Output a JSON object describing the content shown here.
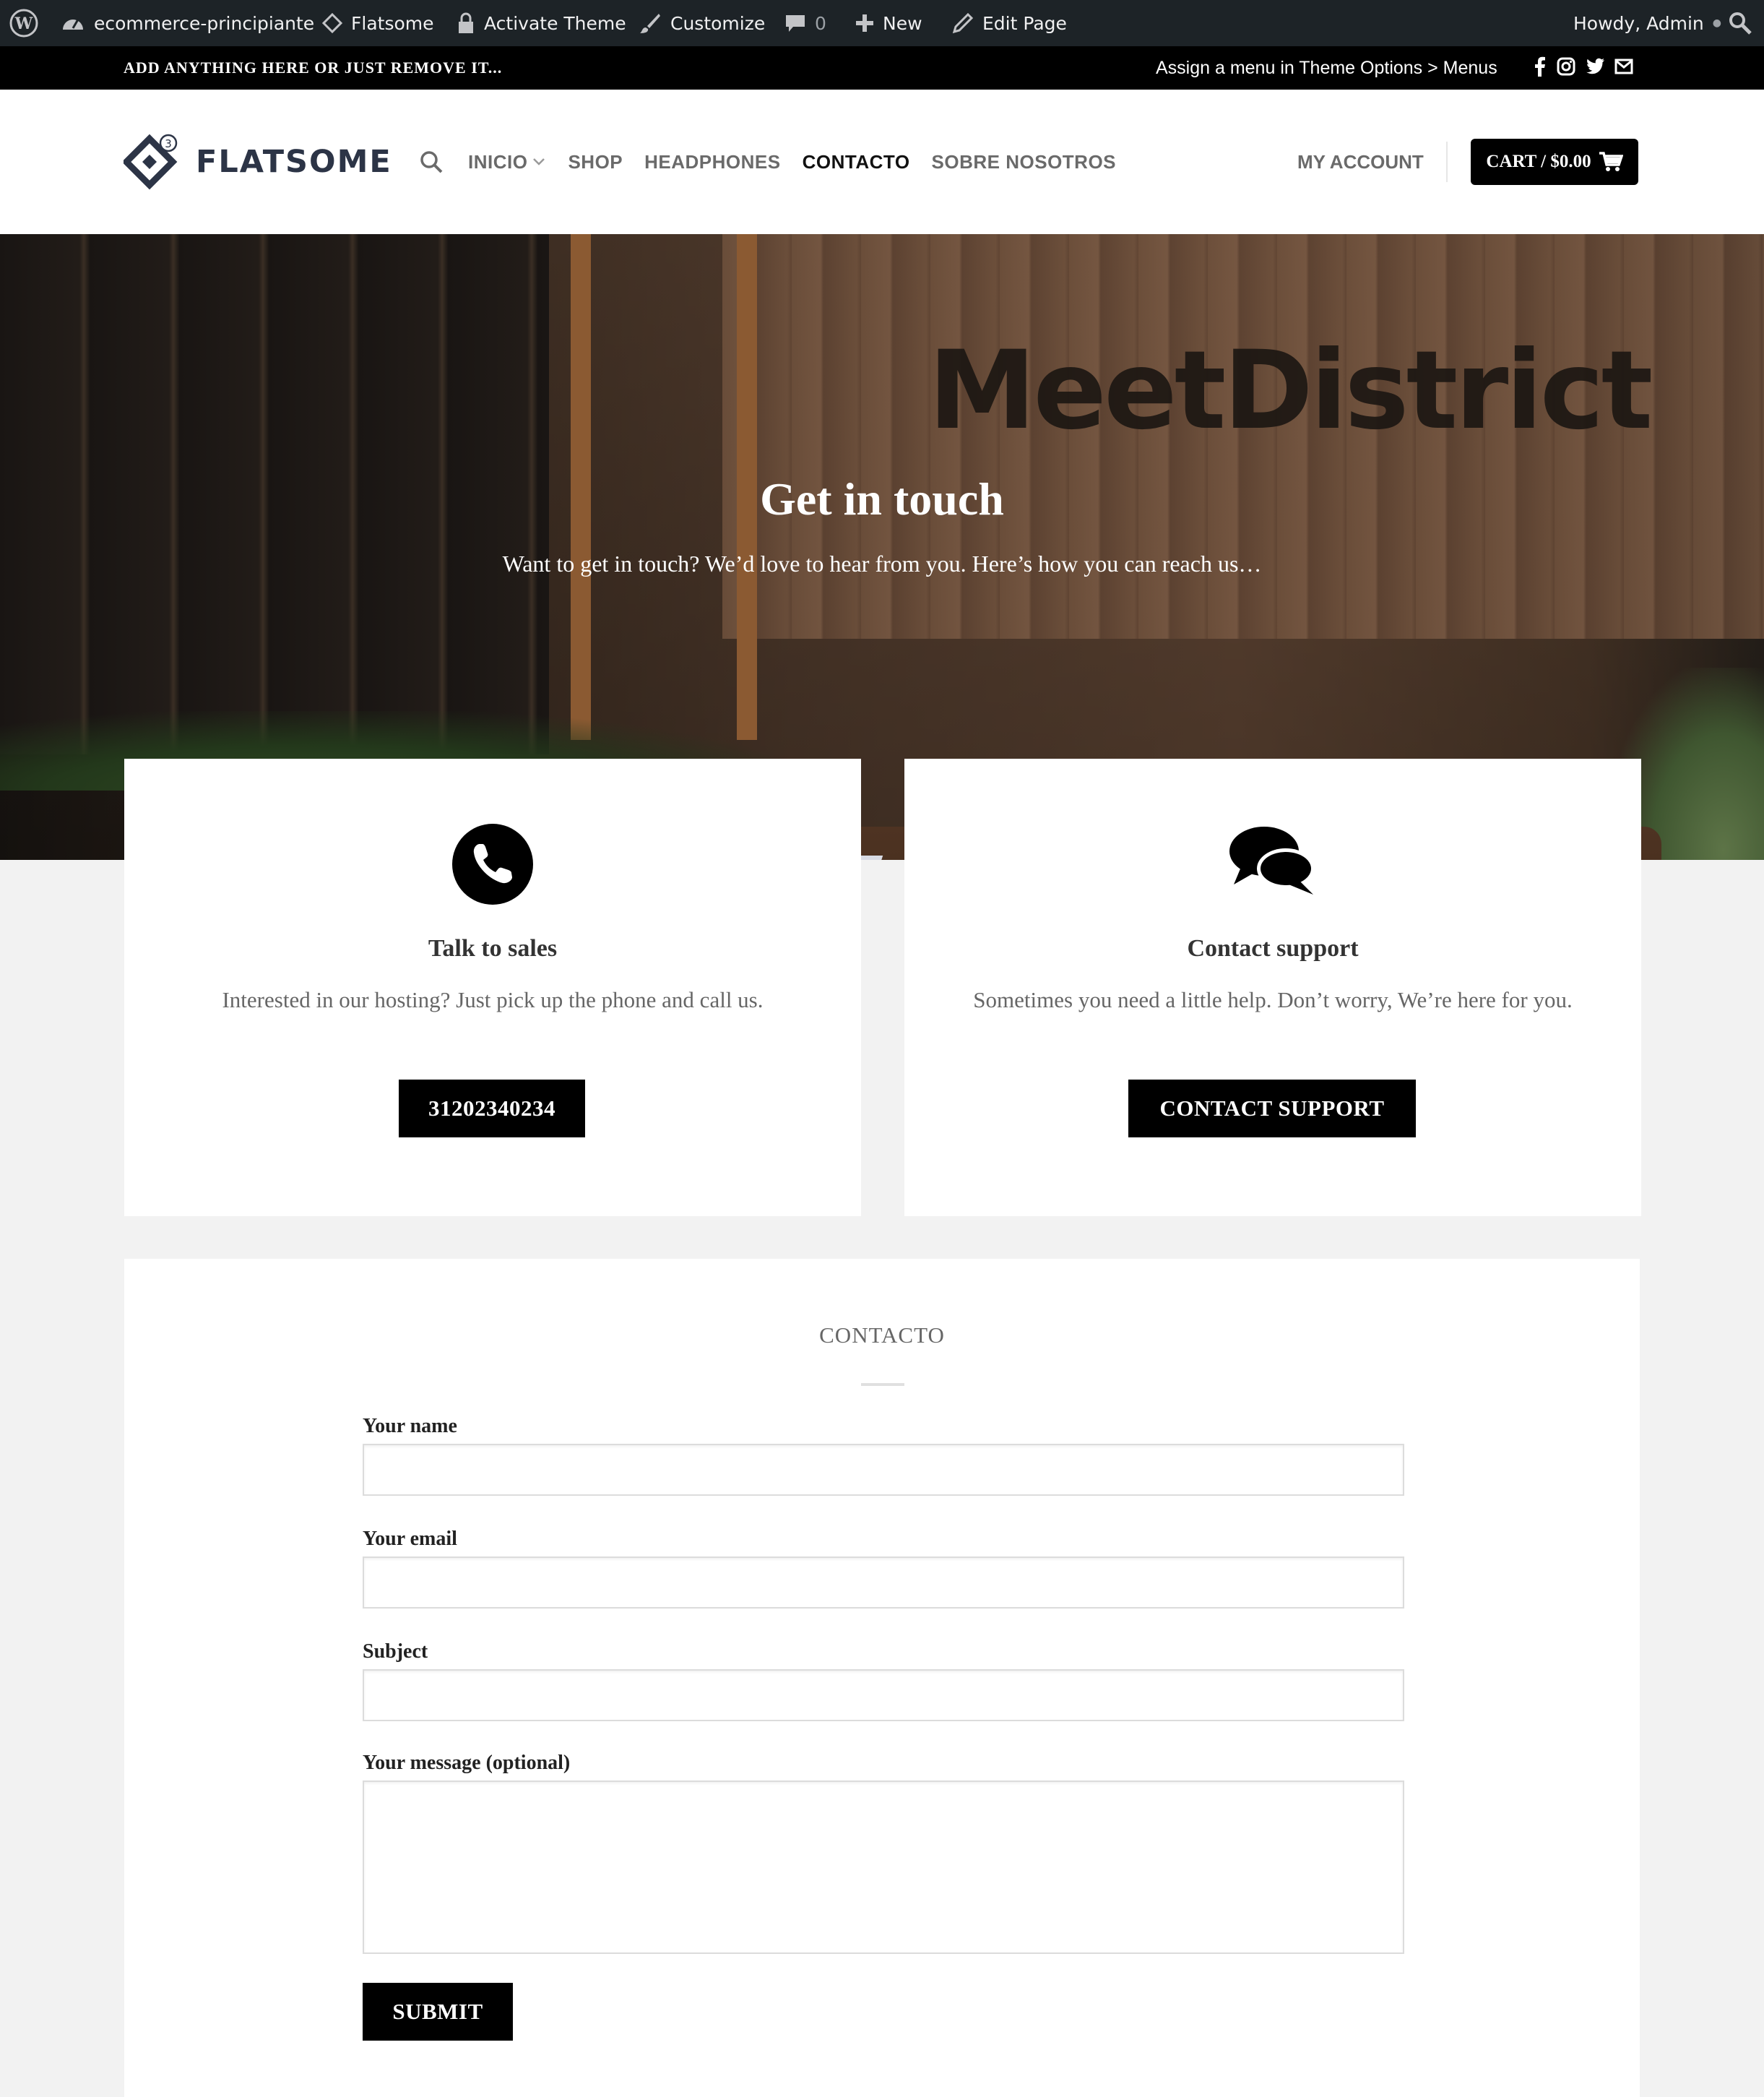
{
  "admin_bar": {
    "site_name": "ecommerce-principiante",
    "theme": "Flatsome",
    "activate_theme": "Activate Theme",
    "customize": "Customize",
    "comments_count": "0",
    "new": "New",
    "edit_page": "Edit Page",
    "howdy": "Howdy, Admin"
  },
  "top_bar": {
    "promo_text": "ADD ANYTHING HERE OR JUST REMOVE IT...",
    "menu_hint": "Assign a menu in Theme Options > Menus",
    "social_icons": [
      "facebook-icon",
      "instagram-icon",
      "twitter-icon",
      "envelope-icon"
    ]
  },
  "header": {
    "logo_text": "FLATSOME",
    "logo_badge": "3",
    "nav": [
      {
        "label": "INICIO",
        "has_dropdown": true
      },
      {
        "label": "SHOP"
      },
      {
        "label": "HEADPHONES"
      },
      {
        "label": "CONTACTO",
        "active": true
      },
      {
        "label": "SOBRE NOSOTROS"
      }
    ],
    "my_account": "MY ACCOUNT",
    "cart": "CART / $0.00"
  },
  "hero": {
    "sign_text": "MeetDistrict",
    "title": "Get in touch",
    "subtitle": "Want to get in touch? We’d love to hear from you. Here’s how you can reach us…"
  },
  "boxes": [
    {
      "icon": "phone-icon",
      "title": "Talk to sales",
      "text": "Interested in our hosting? Just pick up the phone and call us.",
      "button": "31202340234"
    },
    {
      "icon": "chat-bubbles-icon",
      "title": "Contact support",
      "text": "Sometimes you need a little help. Don’t worry, We’re here for you.",
      "button": "CONTACT SUPPORT"
    }
  ],
  "form": {
    "heading": "CONTACTO",
    "fields": [
      {
        "label": "Your name",
        "value": ""
      },
      {
        "label": "Your email",
        "value": ""
      },
      {
        "label": "Subject",
        "value": ""
      },
      {
        "label": "Your message (optional)",
        "value": ""
      }
    ],
    "submit": "SUBMIT"
  },
  "colors": {
    "admin_bar_bg": "#1d2327",
    "top_bar_bg": "#000000",
    "button_bg": "#000000",
    "logo_color": "#2c3446",
    "page_bg": "#f2f2f2"
  }
}
